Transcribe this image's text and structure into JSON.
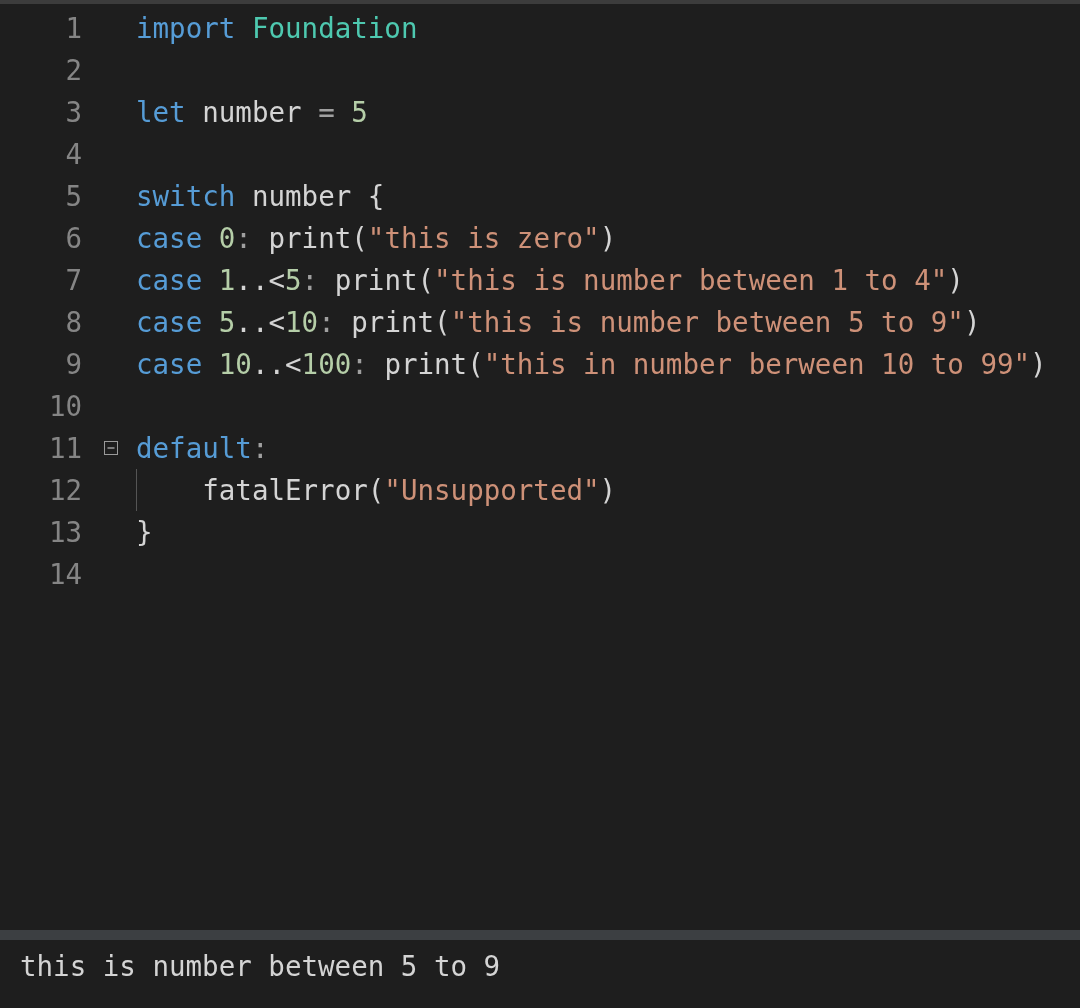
{
  "editor": {
    "lines": [
      {
        "number": "1",
        "tokens": [
          {
            "kind": "keyword",
            "text": "import "
          },
          {
            "kind": "type",
            "text": "Foundation"
          }
        ]
      },
      {
        "number": "2"
      },
      {
        "number": "3",
        "tokens": [
          {
            "kind": "keyword",
            "text": "let"
          },
          {
            "kind": "plain",
            "text": " number "
          },
          {
            "kind": "punct",
            "text": "= "
          },
          {
            "kind": "number",
            "text": "5"
          }
        ]
      },
      {
        "number": "4"
      },
      {
        "number": "5",
        "tokens": [
          {
            "kind": "keyword",
            "text": "switch"
          },
          {
            "kind": "plain",
            "text": " number {"
          }
        ]
      },
      {
        "number": "6",
        "tokens": [
          {
            "kind": "keyword",
            "text": "case "
          },
          {
            "kind": "number",
            "text": "0"
          },
          {
            "kind": "punct",
            "text": ":"
          },
          {
            "kind": "plain",
            "text": " print("
          },
          {
            "kind": "string",
            "text": "\"this is zero\""
          },
          {
            "kind": "plain",
            "text": ")"
          }
        ]
      },
      {
        "number": "7",
        "tokens": [
          {
            "kind": "keyword",
            "text": "case "
          },
          {
            "kind": "number",
            "text": "1"
          },
          {
            "kind": "plain",
            "text": "..<"
          },
          {
            "kind": "number",
            "text": "5"
          },
          {
            "kind": "punct",
            "text": ":"
          },
          {
            "kind": "plain",
            "text": " print("
          },
          {
            "kind": "string",
            "text": "\"this is number between 1 to 4\""
          },
          {
            "kind": "plain",
            "text": ")"
          }
        ]
      },
      {
        "number": "8",
        "tokens": [
          {
            "kind": "keyword",
            "text": "case "
          },
          {
            "kind": "number",
            "text": "5"
          },
          {
            "kind": "plain",
            "text": "..<"
          },
          {
            "kind": "number",
            "text": "10"
          },
          {
            "kind": "punct",
            "text": ":"
          },
          {
            "kind": "plain",
            "text": " print("
          },
          {
            "kind": "string",
            "text": "\"this is number between 5 to 9\""
          },
          {
            "kind": "plain",
            "text": ")"
          }
        ]
      },
      {
        "number": "9",
        "tokens": [
          {
            "kind": "keyword",
            "text": "case "
          },
          {
            "kind": "number",
            "text": "10"
          },
          {
            "kind": "plain",
            "text": "..<"
          },
          {
            "kind": "number",
            "text": "100"
          },
          {
            "kind": "punct",
            "text": ":"
          },
          {
            "kind": "plain",
            "text": " print("
          },
          {
            "kind": "string",
            "text": "\"this in number berween 10 to 99\""
          },
          {
            "kind": "plain",
            "text": ")"
          }
        ]
      },
      {
        "number": "10"
      },
      {
        "number": "11",
        "expanded": true,
        "tokens": [
          {
            "kind": "keyword",
            "text": "default"
          },
          {
            "kind": "punct",
            "text": ":"
          }
        ]
      },
      {
        "number": "12",
        "indented": true,
        "tokens": [
          {
            "kind": "plain",
            "text": "fatalError("
          },
          {
            "kind": "string",
            "text": "\"Unsupported\""
          },
          {
            "kind": "plain",
            "text": ")"
          }
        ]
      },
      {
        "number": "13",
        "tokens": [
          {
            "kind": "plain",
            "text": "}"
          }
        ]
      },
      {
        "number": "14"
      }
    ]
  },
  "output": {
    "text": "this is number between 5 to 9"
  }
}
